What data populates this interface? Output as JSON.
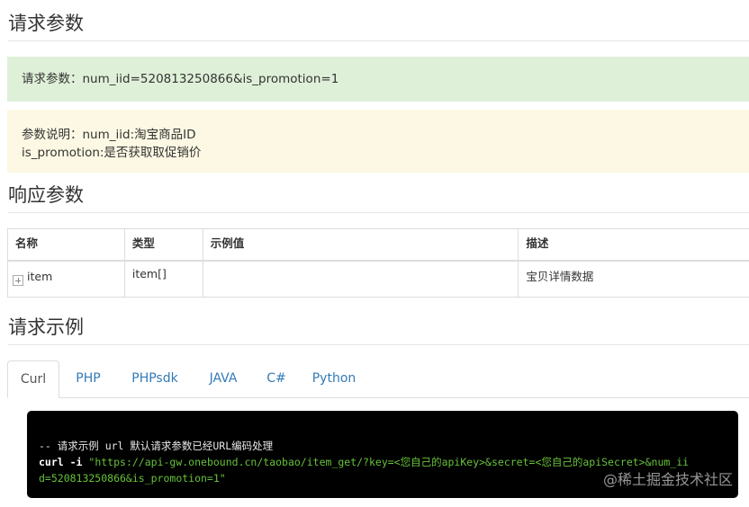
{
  "sections": {
    "request_params": "请求参数",
    "response_params": "响应参数",
    "request_example": "请求示例"
  },
  "alerts": {
    "request": "请求参数：num_iid=520813250866&is_promotion=1",
    "desc_line1": "参数说明：num_iid:淘宝商品ID",
    "desc_line2": "is_promotion:是否获取取促销价"
  },
  "table": {
    "headers": [
      "名称",
      "类型",
      "示例值",
      "描述"
    ],
    "rows": [
      {
        "name": "item",
        "type": "item[]",
        "example": "",
        "desc": "宝贝详情数据"
      }
    ]
  },
  "tabs": [
    "Curl",
    "PHP",
    "PHPsdk",
    "JAVA",
    "C#",
    "Python"
  ],
  "active_tab": "Curl",
  "code": {
    "comment": "-- 请求示例 url 默认请求参数已经URL编码处理",
    "cmd": "curl -i",
    "url_line1": "\"https://api-gw.onebound.cn/taobao/item_get/?key=<您自己的apiKey>&secret=<您自己的apiSecret>&num_ii",
    "url_line2": "d=520813250866&is_promotion=1\""
  },
  "watermark": "@稀土掘金技术社区"
}
